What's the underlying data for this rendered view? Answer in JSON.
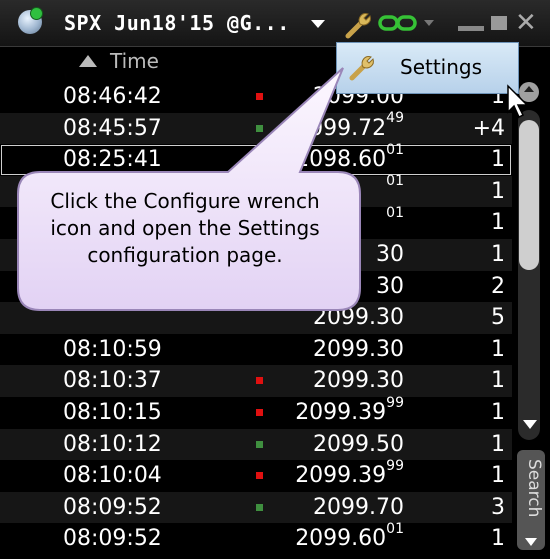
{
  "window": {
    "title": "SPX Jun18'15 @G...",
    "accent_green": "#2fbf3f",
    "up_tick_color": "#3f8f3f",
    "down_tick_color": "#e01010"
  },
  "header": {
    "time_label": "Time"
  },
  "settings_menu": {
    "label": "Settings"
  },
  "callout": {
    "lines": [
      "Click the Configure wrench",
      "icon and open the Settings",
      "configuration page."
    ]
  },
  "search": {
    "label": "Search"
  },
  "trades": [
    {
      "time": "08:46:42",
      "price": "2099.00",
      "sup": "",
      "qty": "1",
      "tick": "down"
    },
    {
      "time": "08:45:57",
      "price": "2099.72",
      "sup": "49",
      "qty": "+4",
      "tick": "up"
    },
    {
      "time": "08:25:41",
      "price": "2098.60",
      "sup": "01",
      "qty": "1",
      "tick": "none"
    },
    {
      "time": "",
      "price": "",
      "sup": "01",
      "qty": "1",
      "tick": "none"
    },
    {
      "time": "",
      "price": "",
      "sup": "01",
      "qty": "1",
      "tick": "none"
    },
    {
      "time": "",
      "price": "30",
      "sup": "",
      "qty": "1",
      "tick": "none"
    },
    {
      "time": "",
      "price": "30",
      "sup": "",
      "qty": "2",
      "tick": "none"
    },
    {
      "time": "",
      "price": "2099.30",
      "sup": "",
      "qty": "5",
      "tick": "none"
    },
    {
      "time": "08:10:59",
      "price": "2099.30",
      "sup": "",
      "qty": "1",
      "tick": "none"
    },
    {
      "time": "08:10:37",
      "price": "2099.30",
      "sup": "",
      "qty": "1",
      "tick": "down"
    },
    {
      "time": "08:10:15",
      "price": "2099.39",
      "sup": "99",
      "qty": "1",
      "tick": "down"
    },
    {
      "time": "08:10:12",
      "price": "2099.50",
      "sup": "",
      "qty": "1",
      "tick": "up"
    },
    {
      "time": "08:10:04",
      "price": "2099.39",
      "sup": "99",
      "qty": "1",
      "tick": "down"
    },
    {
      "time": "08:09:52",
      "price": "2099.70",
      "sup": "",
      "qty": "3",
      "tick": "up"
    },
    {
      "time": "08:09:52",
      "price": "2099.60",
      "sup": "01",
      "qty": "1",
      "tick": "none"
    }
  ]
}
